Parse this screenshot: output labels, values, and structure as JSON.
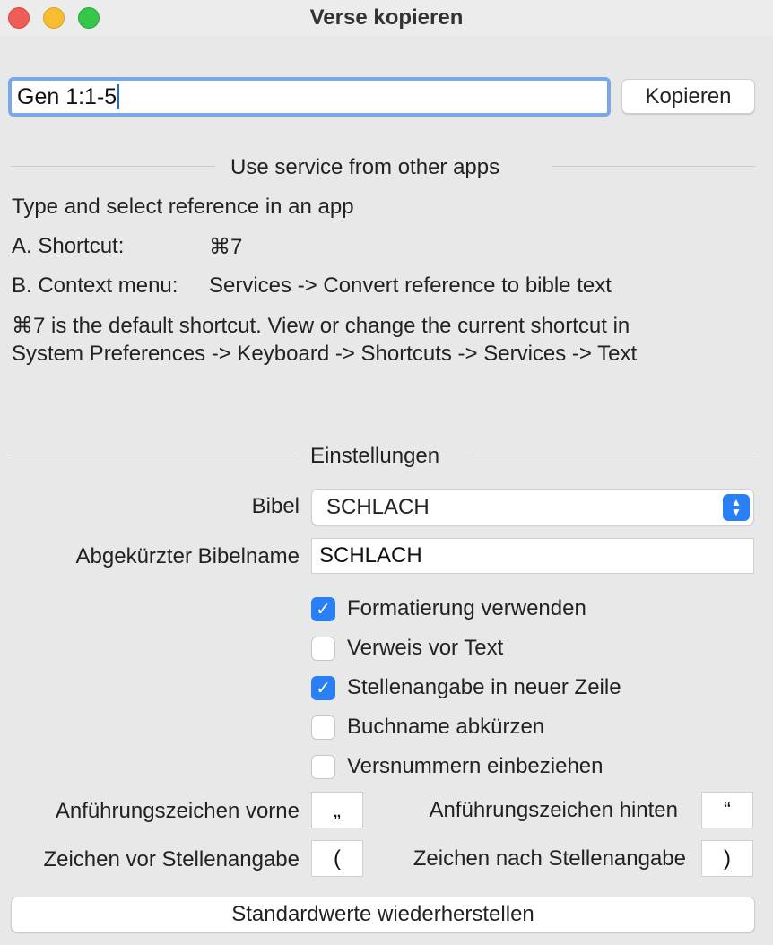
{
  "window": {
    "title": "Verse kopieren"
  },
  "reference": {
    "value": "Gen 1:1-5",
    "copy_label": "Kopieren"
  },
  "service": {
    "heading": "Use service from other apps",
    "line1": "Type and select reference in an app",
    "shortcut_label": "A. Shortcut:",
    "shortcut_value": "⌘7",
    "context_label": "B. Context menu:",
    "context_value": "Services -> Convert reference to bible text",
    "info_line1": "⌘7 is the default shortcut. View or change the current shortcut in",
    "info_line2": "System Preferences -> Keyboard -> Shortcuts -> Services -> Text"
  },
  "settings": {
    "heading": "Einstellungen",
    "bible_label": "Bibel",
    "bible_value": "SCHLACH",
    "abbr_label": "Abgekürzter Bibelname",
    "abbr_value": "SCHLACH",
    "checkboxes": [
      {
        "label": "Formatierung verwenden",
        "checked": true
      },
      {
        "label": "Verweis vor Text",
        "checked": false
      },
      {
        "label": "Stellenangabe in neuer Zeile",
        "checked": true
      },
      {
        "label": "Buchname abkürzen",
        "checked": false
      },
      {
        "label": "Versnummern einbeziehen",
        "checked": false
      }
    ],
    "quote_front_label": "Anführungszeichen vorne",
    "quote_front_value": "„",
    "quote_back_label": "Anführungszeichen hinten",
    "quote_back_value": "“",
    "before_ref_label": "Zeichen vor Stellenangabe",
    "before_ref_value": "(",
    "after_ref_label": "Zeichen nach Stellenangabe",
    "after_ref_value": ")",
    "reset_label": "Standardwerte wiederherstellen"
  },
  "colors": {
    "accent": "#2a7ff5",
    "focus_ring": "#7aa7e8"
  }
}
